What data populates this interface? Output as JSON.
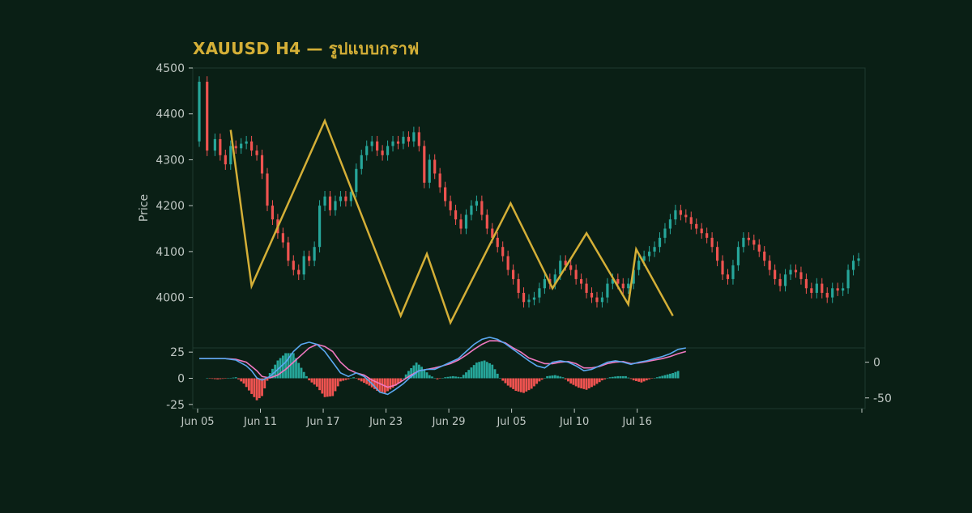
{
  "title": "XAUUSD H4 — รูปแบบกราฟ",
  "colors": {
    "background": "#0a1f15",
    "up": "#26a69a",
    "down": "#ef5350",
    "pattern": "#d4af37",
    "macd_line": "#5aa8f0",
    "signal_line": "#f078c0",
    "axis_text": "#c0c8c4"
  },
  "chart_data": [
    {
      "type": "candlestick",
      "name": "price",
      "ylabel": "Price",
      "ylim": [
        3890,
        4500
      ],
      "yticks": [
        4000,
        4100,
        4200,
        4300,
        4400,
        4500
      ],
      "x_range": [
        0,
        252
      ],
      "close_series": [
        [
          0,
          4470
        ],
        [
          3,
          4320
        ],
        [
          6,
          4345
        ],
        [
          8,
          4310
        ],
        [
          10,
          4290
        ],
        [
          12,
          4330
        ],
        [
          14,
          4325
        ],
        [
          16,
          4335
        ],
        [
          18,
          4340
        ],
        [
          20,
          4320
        ],
        [
          22,
          4310
        ],
        [
          24,
          4270
        ],
        [
          26,
          4200
        ],
        [
          28,
          4170
        ],
        [
          30,
          4140
        ],
        [
          32,
          4120
        ],
        [
          34,
          4080
        ],
        [
          36,
          4060
        ],
        [
          38,
          4050
        ],
        [
          40,
          4090
        ],
        [
          42,
          4080
        ],
        [
          44,
          4110
        ],
        [
          46,
          4200
        ],
        [
          48,
          4220
        ],
        [
          50,
          4190
        ],
        [
          52,
          4210
        ],
        [
          54,
          4220
        ],
        [
          56,
          4210
        ],
        [
          58,
          4230
        ],
        [
          60,
          4280
        ],
        [
          62,
          4310
        ],
        [
          64,
          4330
        ],
        [
          66,
          4340
        ],
        [
          68,
          4320
        ],
        [
          70,
          4310
        ],
        [
          72,
          4330
        ],
        [
          74,
          4340
        ],
        [
          76,
          4335
        ],
        [
          78,
          4350
        ],
        [
          80,
          4340
        ],
        [
          82,
          4360
        ],
        [
          84,
          4330
        ],
        [
          86,
          4250
        ],
        [
          88,
          4300
        ],
        [
          90,
          4270
        ],
        [
          92,
          4240
        ],
        [
          94,
          4210
        ],
        [
          96,
          4190
        ],
        [
          98,
          4170
        ],
        [
          100,
          4150
        ],
        [
          102,
          4180
        ],
        [
          104,
          4200
        ],
        [
          106,
          4210
        ],
        [
          108,
          4180
        ],
        [
          110,
          4150
        ],
        [
          112,
          4130
        ],
        [
          114,
          4110
        ],
        [
          116,
          4090
        ],
        [
          118,
          4060
        ],
        [
          120,
          4040
        ],
        [
          122,
          4010
        ],
        [
          124,
          3990
        ],
        [
          126,
          3995
        ],
        [
          128,
          4000
        ],
        [
          130,
          4020
        ],
        [
          132,
          4040
        ],
        [
          134,
          4030
        ],
        [
          136,
          4050
        ],
        [
          138,
          4080
        ],
        [
          140,
          4070
        ],
        [
          142,
          4060
        ],
        [
          144,
          4040
        ],
        [
          146,
          4030
        ],
        [
          148,
          4010
        ],
        [
          150,
          4000
        ],
        [
          152,
          3990
        ],
        [
          154,
          4000
        ],
        [
          156,
          4030
        ],
        [
          158,
          4040
        ],
        [
          160,
          4030
        ],
        [
          162,
          4020
        ],
        [
          164,
          4030
        ],
        [
          166,
          4060
        ],
        [
          168,
          4080
        ],
        [
          170,
          4090
        ],
        [
          172,
          4100
        ],
        [
          174,
          4110
        ],
        [
          176,
          4130
        ],
        [
          178,
          4150
        ],
        [
          180,
          4170
        ],
        [
          182,
          4190
        ],
        [
          184,
          4180
        ],
        [
          186,
          4175
        ],
        [
          188,
          4160
        ],
        [
          190,
          4150
        ],
        [
          192,
          4140
        ],
        [
          194,
          4130
        ],
        [
          196,
          4110
        ],
        [
          198,
          4080
        ],
        [
          200,
          4050
        ],
        [
          202,
          4040
        ],
        [
          204,
          4070
        ],
        [
          206,
          4110
        ],
        [
          208,
          4130
        ],
        [
          210,
          4125
        ],
        [
          212,
          4115
        ],
        [
          214,
          4100
        ],
        [
          216,
          4080
        ],
        [
          218,
          4060
        ],
        [
          220,
          4040
        ],
        [
          222,
          4025
        ],
        [
          224,
          4050
        ],
        [
          226,
          4060
        ],
        [
          228,
          4055
        ],
        [
          230,
          4040
        ],
        [
          232,
          4020
        ],
        [
          234,
          4010
        ],
        [
          236,
          4030
        ],
        [
          238,
          4010
        ],
        [
          240,
          4000
        ],
        [
          242,
          4020
        ],
        [
          244,
          4015
        ],
        [
          246,
          4020
        ],
        [
          248,
          4060
        ],
        [
          250,
          4080
        ],
        [
          252,
          4085
        ]
      ],
      "pattern_zigzag": [
        [
          12,
          4365
        ],
        [
          20,
          4025
        ],
        [
          48,
          4385
        ],
        [
          77,
          3960
        ],
        [
          87,
          4095
        ],
        [
          96,
          3945
        ],
        [
          119,
          4205
        ],
        [
          135,
          4020
        ],
        [
          148,
          4140
        ],
        [
          164,
          3985
        ],
        [
          167,
          4105
        ],
        [
          181,
          3960
        ]
      ]
    },
    {
      "type": "macd",
      "name": "indicator",
      "ylim_left": [
        -29,
        29
      ],
      "yticks_left": [
        25,
        0,
        -25
      ],
      "ylim_right": [
        -65,
        20
      ],
      "yticks_right": [
        0,
        -50
      ],
      "histogram": [
        [
          3,
          0
        ],
        [
          7,
          -1
        ],
        [
          11,
          0
        ],
        [
          14,
          1
        ],
        [
          17,
          -5
        ],
        [
          20,
          -15
        ],
        [
          22,
          -21
        ],
        [
          24,
          -17
        ],
        [
          27,
          5
        ],
        [
          30,
          17
        ],
        [
          33,
          24
        ],
        [
          36,
          24
        ],
        [
          39,
          10
        ],
        [
          42,
          -2
        ],
        [
          45,
          -8
        ],
        [
          48,
          -18
        ],
        [
          51,
          -17
        ],
        [
          54,
          -3
        ],
        [
          57,
          -1
        ],
        [
          59,
          1
        ],
        [
          62,
          -3
        ],
        [
          65,
          -7
        ],
        [
          68,
          -12
        ],
        [
          71,
          -14
        ],
        [
          74,
          -9
        ],
        [
          77,
          -3
        ],
        [
          80,
          7
        ],
        [
          83,
          15
        ],
        [
          85,
          11
        ],
        [
          88,
          3
        ],
        [
          91,
          -1
        ],
        [
          94,
          1
        ],
        [
          97,
          2
        ],
        [
          100,
          1
        ],
        [
          103,
          8
        ],
        [
          106,
          15
        ],
        [
          109,
          17
        ],
        [
          112,
          13
        ],
        [
          115,
          0
        ],
        [
          118,
          -7
        ],
        [
          121,
          -12
        ],
        [
          124,
          -14
        ],
        [
          127,
          -10
        ],
        [
          130,
          -3
        ],
        [
          133,
          2
        ],
        [
          136,
          3
        ],
        [
          139,
          1
        ],
        [
          142,
          -5
        ],
        [
          145,
          -9
        ],
        [
          148,
          -11
        ],
        [
          151,
          -7
        ],
        [
          154,
          -2
        ],
        [
          157,
          1
        ],
        [
          160,
          2
        ],
        [
          163,
          2
        ],
        [
          166,
          -2
        ],
        [
          169,
          -4
        ],
        [
          172,
          -1
        ],
        [
          175,
          1
        ],
        [
          178,
          3
        ],
        [
          181,
          5
        ],
        [
          184,
          8
        ]
      ],
      "macd_line": [
        [
          0,
          5
        ],
        [
          4,
          5
        ],
        [
          8,
          5
        ],
        [
          10,
          5
        ],
        [
          14,
          3
        ],
        [
          18,
          -5
        ],
        [
          20,
          -12
        ],
        [
          22,
          -22
        ],
        [
          24,
          -25
        ],
        [
          27,
          -20
        ],
        [
          30,
          -10
        ],
        [
          33,
          0
        ],
        [
          36,
          15
        ],
        [
          39,
          25
        ],
        [
          42,
          28
        ],
        [
          45,
          25
        ],
        [
          48,
          15
        ],
        [
          51,
          0
        ],
        [
          54,
          -15
        ],
        [
          57,
          -20
        ],
        [
          60,
          -15
        ],
        [
          63,
          -20
        ],
        [
          66,
          -30
        ],
        [
          69,
          -42
        ],
        [
          72,
          -45
        ],
        [
          75,
          -38
        ],
        [
          78,
          -30
        ],
        [
          81,
          -20
        ],
        [
          84,
          -12
        ],
        [
          87,
          -10
        ],
        [
          90,
          -10
        ],
        [
          93,
          -5
        ],
        [
          96,
          0
        ],
        [
          99,
          5
        ],
        [
          102,
          15
        ],
        [
          105,
          25
        ],
        [
          108,
          32
        ],
        [
          111,
          35
        ],
        [
          114,
          32
        ],
        [
          117,
          26
        ],
        [
          120,
          18
        ],
        [
          123,
          10
        ],
        [
          126,
          2
        ],
        [
          129,
          -5
        ],
        [
          132,
          -8
        ],
        [
          135,
          0
        ],
        [
          138,
          2
        ],
        [
          141,
          0
        ],
        [
          144,
          -5
        ],
        [
          147,
          -12
        ],
        [
          150,
          -10
        ],
        [
          153,
          -5
        ],
        [
          156,
          0
        ],
        [
          159,
          2
        ],
        [
          162,
          0
        ],
        [
          165,
          -3
        ],
        [
          168,
          0
        ],
        [
          171,
          2
        ],
        [
          174,
          5
        ],
        [
          177,
          8
        ],
        [
          180,
          12
        ],
        [
          183,
          18
        ],
        [
          186,
          20
        ]
      ],
      "signal_line": [
        [
          0,
          5
        ],
        [
          4,
          5
        ],
        [
          8,
          5
        ],
        [
          10,
          5
        ],
        [
          14,
          4
        ],
        [
          18,
          0
        ],
        [
          20,
          -6
        ],
        [
          22,
          -12
        ],
        [
          24,
          -20
        ],
        [
          27,
          -22
        ],
        [
          30,
          -18
        ],
        [
          33,
          -10
        ],
        [
          36,
          0
        ],
        [
          39,
          10
        ],
        [
          42,
          20
        ],
        [
          45,
          25
        ],
        [
          48,
          22
        ],
        [
          51,
          15
        ],
        [
          54,
          0
        ],
        [
          57,
          -10
        ],
        [
          60,
          -15
        ],
        [
          63,
          -18
        ],
        [
          66,
          -25
        ],
        [
          69,
          -30
        ],
        [
          72,
          -35
        ],
        [
          75,
          -32
        ],
        [
          78,
          -25
        ],
        [
          81,
          -18
        ],
        [
          84,
          -12
        ],
        [
          87,
          -10
        ],
        [
          90,
          -8
        ],
        [
          93,
          -5
        ],
        [
          96,
          -2
        ],
        [
          99,
          3
        ],
        [
          102,
          10
        ],
        [
          105,
          18
        ],
        [
          108,
          25
        ],
        [
          111,
          30
        ],
        [
          114,
          30
        ],
        [
          117,
          27
        ],
        [
          120,
          20
        ],
        [
          123,
          14
        ],
        [
          126,
          6
        ],
        [
          129,
          2
        ],
        [
          132,
          -2
        ],
        [
          135,
          -2
        ],
        [
          138,
          0
        ],
        [
          141,
          1
        ],
        [
          144,
          -2
        ],
        [
          147,
          -8
        ],
        [
          150,
          -8
        ],
        [
          153,
          -6
        ],
        [
          156,
          -2
        ],
        [
          159,
          0
        ],
        [
          162,
          1
        ],
        [
          165,
          -2
        ],
        [
          168,
          -1
        ],
        [
          171,
          1
        ],
        [
          174,
          3
        ],
        [
          177,
          5
        ],
        [
          180,
          8
        ],
        [
          183,
          12
        ],
        [
          186,
          15
        ]
      ]
    }
  ],
  "x_axis": {
    "tick_labels": [
      "Jun 05",
      "Jun 11",
      "Jun 17",
      "Jun 23",
      "Jun 29",
      "Jul 05",
      "Jul 10",
      "Jul 16"
    ],
    "tick_positions": [
      0,
      24,
      48,
      72,
      96,
      120,
      144,
      168
    ]
  }
}
